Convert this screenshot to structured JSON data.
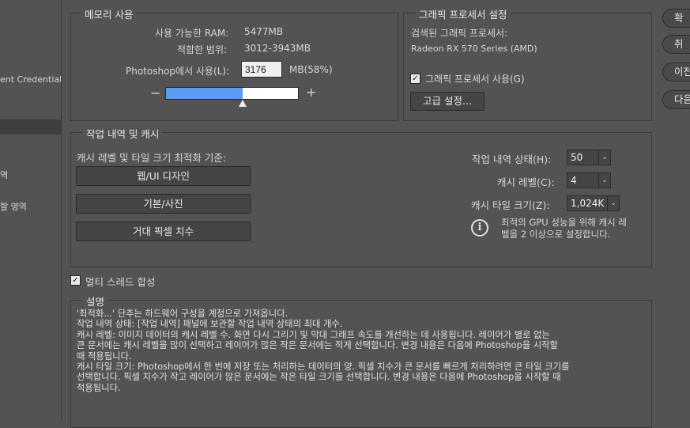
{
  "sidebar": {
    "items": [
      {
        "label": "ent Credentials"
      },
      {
        "label": ""
      },
      {
        "label": "역"
      },
      {
        "label": "할 영역"
      }
    ]
  },
  "memory": {
    "title": "메모리 사용",
    "available_label": "사용 가능한 RAM:",
    "available_value": "5477MB",
    "range_label": "적합한 범위:",
    "range_value": "3012-3943MB",
    "use_label": "Photoshop에서 사용(L):",
    "use_value": "3176",
    "use_unit": "MB(58%)",
    "minus": "−",
    "plus": "+",
    "slider_percent": 58
  },
  "gpu": {
    "title": "그래픽 프로세서 설정",
    "detected_label": "검색된 그래픽 프로세서:",
    "detected_value": "Radeon RX 570 Series (AMD)",
    "use_gpu_label": "그래픽 프로세서 사용(G)",
    "use_gpu_checked": true,
    "advanced_button": "고급 설정..."
  },
  "history": {
    "title": "작업 내역 및 캐시",
    "optimize_label": "캐시 레벨 및 타일 크기 최적화 기준:",
    "buttons": [
      "웹/UI 디자인",
      "기본/사진",
      "거대 픽셀 치수"
    ],
    "states_label": "작업 내역 상태(H):",
    "states_value": "50",
    "levels_label": "캐시 레벨(C):",
    "levels_value": "4",
    "tile_label": "캐시 타일 크기(Z):",
    "tile_value": "1,024K",
    "info_icon": "info-icon",
    "info_text_1": "최적의 GPU 성능을 위해 캐시 레",
    "info_text_2": "벨을 2 이상으로 설정합니다."
  },
  "multithread": {
    "label": "멀티 스레드 합성",
    "checked": true
  },
  "description": {
    "title": "설명",
    "text": "'최적화...' 단추는 하드웨어 구성을 계정으로 가져옵니다.\n작업 내역 상태: [작업 내역] 패널에 보관할 작업 내역 상태의 최대 개수.\n캐시 레벨: 이미지 데이터의 캐시 레벨 수. 화면 다시 그리기 및 막대 그래프 속도를 개선하는 데 사용됩니다. 레이어가 별로 없는\n큰 문서에는 캐시 레벨을 많이 선택하고 레이어가 많은 작은 문서에는 적게 선택합니다. 변경 내용은 다음에 Photoshop을 시작할\n때 적용됩니다.\n캐시 타일 크기: Photoshop에서 한 번에 저장 또는 처리하는 데이터의 양. 픽셀 치수가 큰 문서를 빠르게 처리하려면 큰 타일 크기를\n선택합니다. 픽셀 치수가 작고 레이어가 많은 문서에는 작은 타일 크기를 선택합니다. 변경 내용은 다음에 Photoshop을 시작할 때\n적용됩니다."
  },
  "right_buttons": [
    "확",
    "취",
    "이전",
    "다음"
  ],
  "colors": {
    "background": "#535353",
    "slider_fill": "#5b9bf0"
  }
}
